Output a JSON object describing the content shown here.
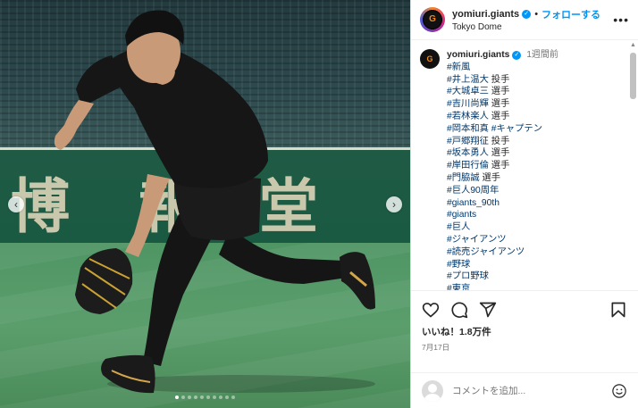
{
  "post": {
    "account": {
      "username": "yomiuri.giants",
      "verified": true,
      "follow_label": "フォローする",
      "separator": "•",
      "location": "Tokyo Dome",
      "more_icon": "more-horizontal-icon"
    },
    "media": {
      "banner_chars": [
        "博",
        "報",
        "堂"
      ],
      "prev_icon": "chevron-left-icon",
      "next_icon": "chevron-right-icon",
      "carousel_total": 10,
      "carousel_active": 1
    },
    "caption": {
      "username": "yomiuri.giants",
      "time": "1週間前",
      "lines": [
        {
          "tag": "#新風",
          "text": ""
        },
        {
          "tag": "#井上温大",
          "text": " 投手"
        },
        {
          "tag": "#大城卓三",
          "text": " 選手"
        },
        {
          "tag": "#吉川尚輝",
          "text": " 選手"
        },
        {
          "tag": "#若林楽人",
          "text": " 選手"
        },
        {
          "tag": "#岡本和真",
          "text": " #キャプテン"
        },
        {
          "tag": "#戸郷翔征",
          "text": " 投手"
        },
        {
          "tag": "#坂本勇人",
          "text": " 選手"
        },
        {
          "tag": "#岸田行倫",
          "text": " 選手"
        },
        {
          "tag": "#門脇誠",
          "text": " 選手"
        },
        {
          "tag": "#巨人90周年",
          "text": ""
        },
        {
          "tag": "#giants_90th",
          "text": ""
        },
        {
          "tag": "#giants",
          "text": ""
        },
        {
          "tag": "#巨人",
          "text": ""
        },
        {
          "tag": "#ジャイアンツ",
          "text": ""
        },
        {
          "tag": "#読売ジャイアンツ",
          "text": ""
        },
        {
          "tag": "#野球",
          "text": ""
        },
        {
          "tag": "#プロ野球",
          "text": ""
        },
        {
          "tag": "#東京",
          "text": ""
        }
      ]
    },
    "actions": {
      "like_icon": "heart-icon",
      "comment_icon": "comment-icon",
      "share_icon": "send-icon",
      "bookmark_icon": "bookmark-icon",
      "likes_text": "いいね！1.8万件",
      "date": "7月17日"
    },
    "comment_box": {
      "placeholder": "コメントを追加...",
      "emoji_icon": "emoji-icon"
    }
  },
  "colors": {
    "link_blue": "#0095f6",
    "hashtag": "#00376b",
    "muted": "#737373",
    "giants_orange": "#f08a1d"
  }
}
